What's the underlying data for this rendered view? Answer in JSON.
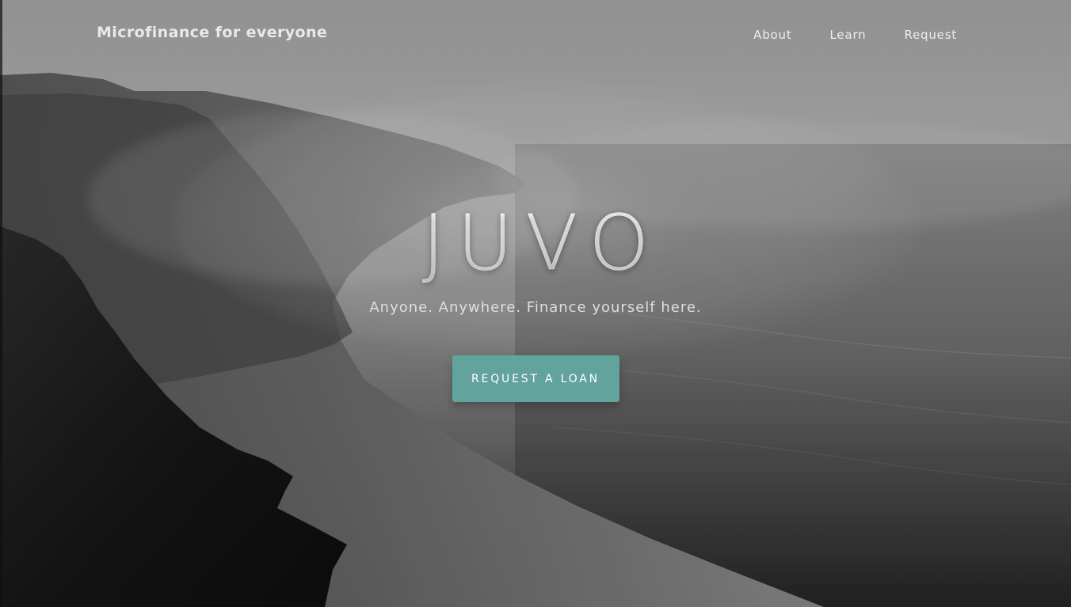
{
  "header": {
    "brand": "Microfinance for everyone",
    "nav": [
      "About",
      "Learn",
      "Request"
    ]
  },
  "hero": {
    "title": "JUVO",
    "subtitle": "Anyone. Anywhere. Finance yourself here.",
    "cta": "REQUEST A LOAN"
  },
  "theme": {
    "accent": "#63a39d",
    "background": "grayscale misty cliff and sea"
  }
}
